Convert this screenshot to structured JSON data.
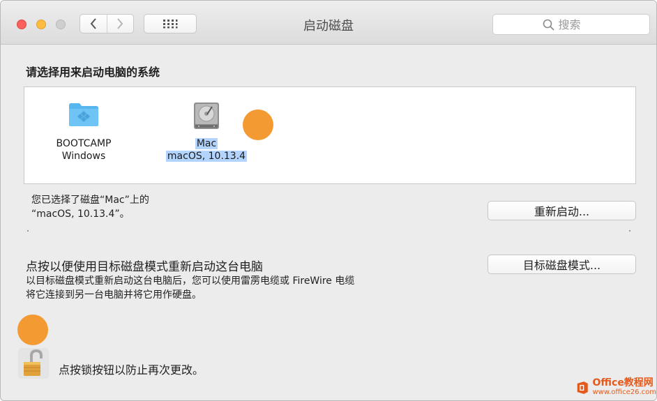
{
  "window": {
    "title": "启动磁盘",
    "search_placeholder": "搜索",
    "icons": {
      "back": "chevron-left-icon",
      "forward": "chevron-right-icon",
      "grid": "grid-icon",
      "search": "search-icon"
    }
  },
  "main": {
    "heading": "请选择用来启动电脑的系统",
    "disks": [
      {
        "name": "BOOTCAMP",
        "system": "Windows",
        "icon": "folder-icon",
        "selected": false
      },
      {
        "name": "Mac",
        "system": "macOS, 10.13.4",
        "icon": "hard-drive-icon",
        "selected": true
      }
    ],
    "status_line1": "您已选择了磁盘“Mac”上的",
    "status_line2": "“macOS, 10.13.4”。",
    "restart_label": "重新启动...",
    "target_title": "点按以便使用目标磁盘模式重新启动这台电脑",
    "target_desc_line1": "以目标磁盘模式重新启动这台电脑后，您可以使用雷雳电缆或 FireWire 电缆",
    "target_desc_line2": "将它连接到另一台电脑并将它用作硬盘。",
    "target_button_label": "目标磁盘模式...",
    "lock_text": "点按锁按钮以防止再次更改。",
    "lock_state": "unlocked"
  },
  "watermark": {
    "brand": "Office教程网",
    "url": "www.office26.com"
  },
  "colors": {
    "close": "#fc605c",
    "minimize": "#fdbc40",
    "zoom": "#cfcfcf",
    "selection": "#b3d4fc",
    "marker": "#f39b32",
    "watermark": "#e45a1c"
  }
}
